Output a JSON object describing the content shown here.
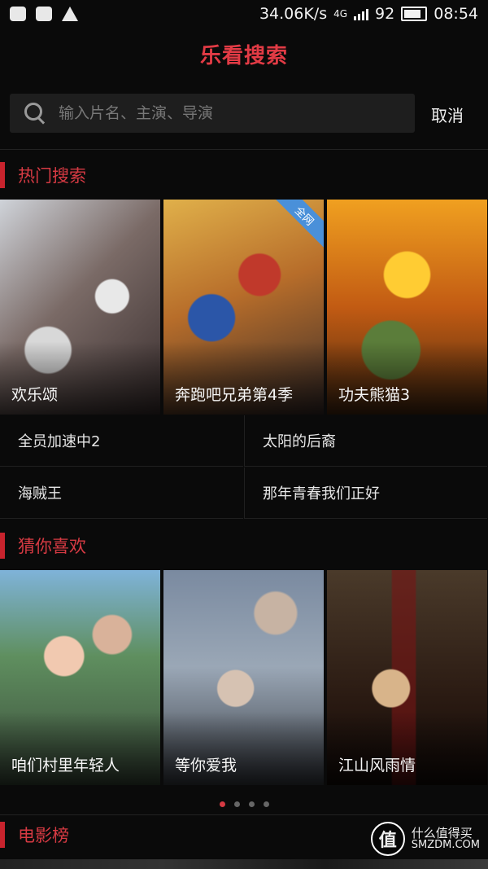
{
  "status_bar": {
    "speed": "34.06K/s",
    "network": "4G",
    "battery": "92",
    "time": "08:54"
  },
  "header": {
    "title": "乐看搜索"
  },
  "search": {
    "placeholder": "输入片名、主演、导演",
    "cancel_label": "取消"
  },
  "hot": {
    "title": "热门搜索",
    "posters": [
      {
        "title": "欢乐颂"
      },
      {
        "title": "奔跑吧兄弟第4季",
        "badge": "全网"
      },
      {
        "title": "功夫熊猫3"
      }
    ],
    "list": [
      "全员加速中2",
      "太阳的后裔",
      "海贼王",
      "那年青春我们正好"
    ]
  },
  "recommend": {
    "title": "猜你喜欢",
    "posters": [
      {
        "title": "咱们村里年轻人"
      },
      {
        "title": "等你爱我"
      },
      {
        "title": "江山风雨情"
      }
    ],
    "pager": {
      "count": 4,
      "active": 0
    }
  },
  "movie_rank": {
    "title": "电影榜"
  },
  "watermark": {
    "logo": "值",
    "line1": "什么值得买",
    "line2": "SMZDM.COM"
  }
}
